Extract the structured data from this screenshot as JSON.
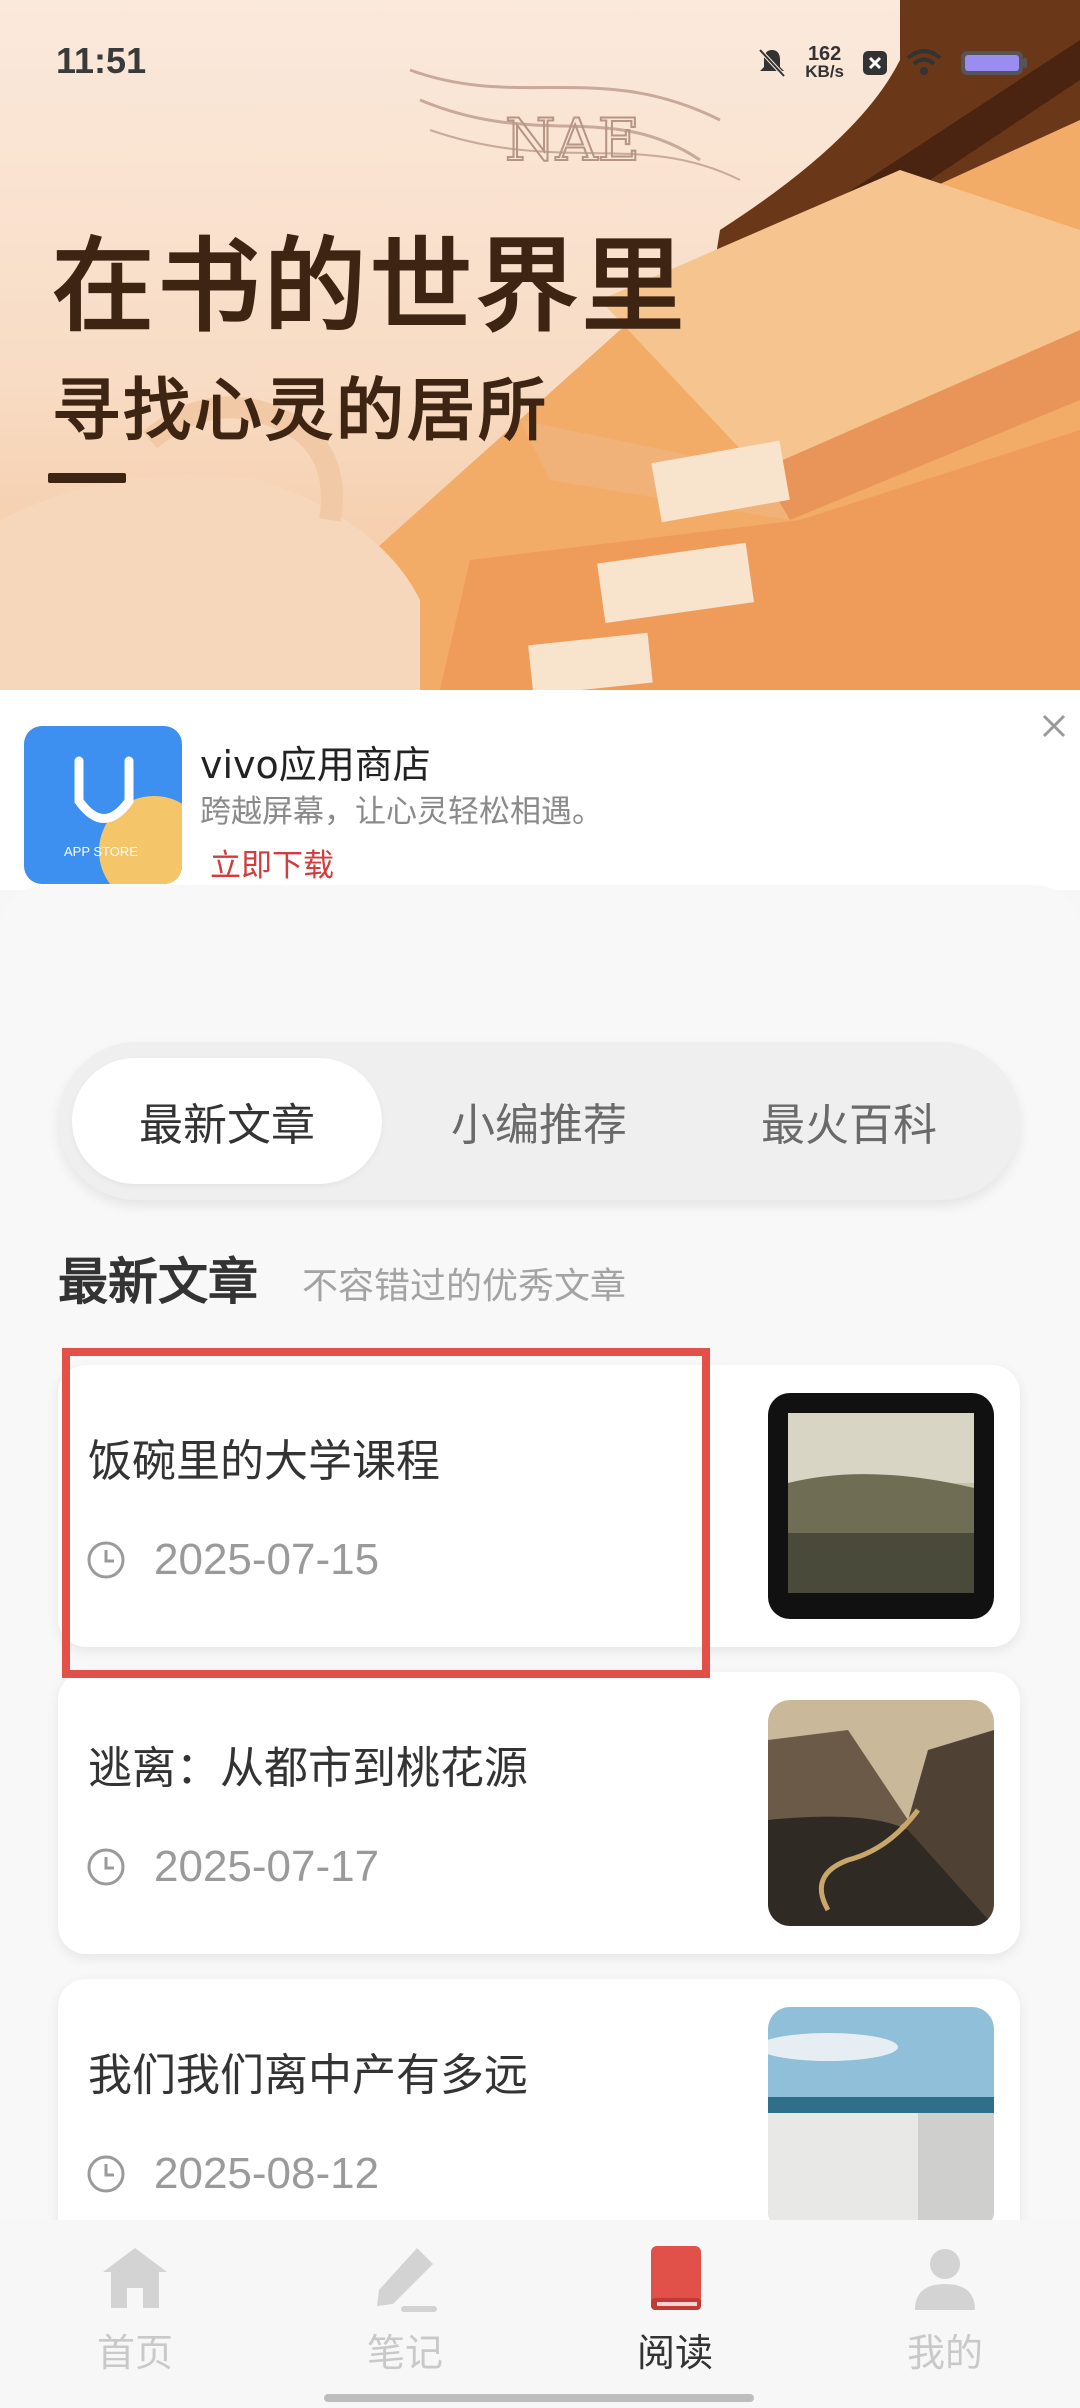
{
  "status_bar": {
    "time": "11:51",
    "speed_value": "162",
    "speed_unit": "KB/s"
  },
  "banner": {
    "title": "在书的世界里",
    "subtitle": "寻找心灵的居所",
    "art_letters": "NAE"
  },
  "ad": {
    "app_name": "vivo应用商店",
    "description": "跨越屏幕，让心灵轻松相遇。",
    "cta": "立即下载",
    "icon_text": "APP STORE"
  },
  "tabs": [
    {
      "label": "最新文章",
      "active": true
    },
    {
      "label": "小编推荐",
      "active": false
    },
    {
      "label": "最火百科",
      "active": false
    }
  ],
  "section": {
    "title": "最新文章",
    "subtitle": "不容错过的优秀文章"
  },
  "articles": [
    {
      "title": "饭碗里的大学课程",
      "date": "2025-07-15",
      "thumb": "train-window-landscape"
    },
    {
      "title": "逃离：从都市到桃花源",
      "date": "2025-07-17",
      "thumb": "mountain-road-valley"
    },
    {
      "title": "我们我们离中产有多远",
      "date": "2025-08-12",
      "thumb": "sea-and-wall"
    }
  ],
  "bottom_nav": [
    {
      "label": "首页",
      "icon": "home-icon",
      "active": false
    },
    {
      "label": "笔记",
      "icon": "pencil-icon",
      "active": false
    },
    {
      "label": "阅读",
      "icon": "book-icon",
      "active": true
    },
    {
      "label": "我的",
      "icon": "user-icon",
      "active": false
    }
  ],
  "colors": {
    "accent_red": "#e2504a",
    "active_tab_text": "#333333",
    "inactive_nav": "#c9c9c9",
    "banner_text": "#3e2513",
    "cta_red": "#d23c3c"
  }
}
